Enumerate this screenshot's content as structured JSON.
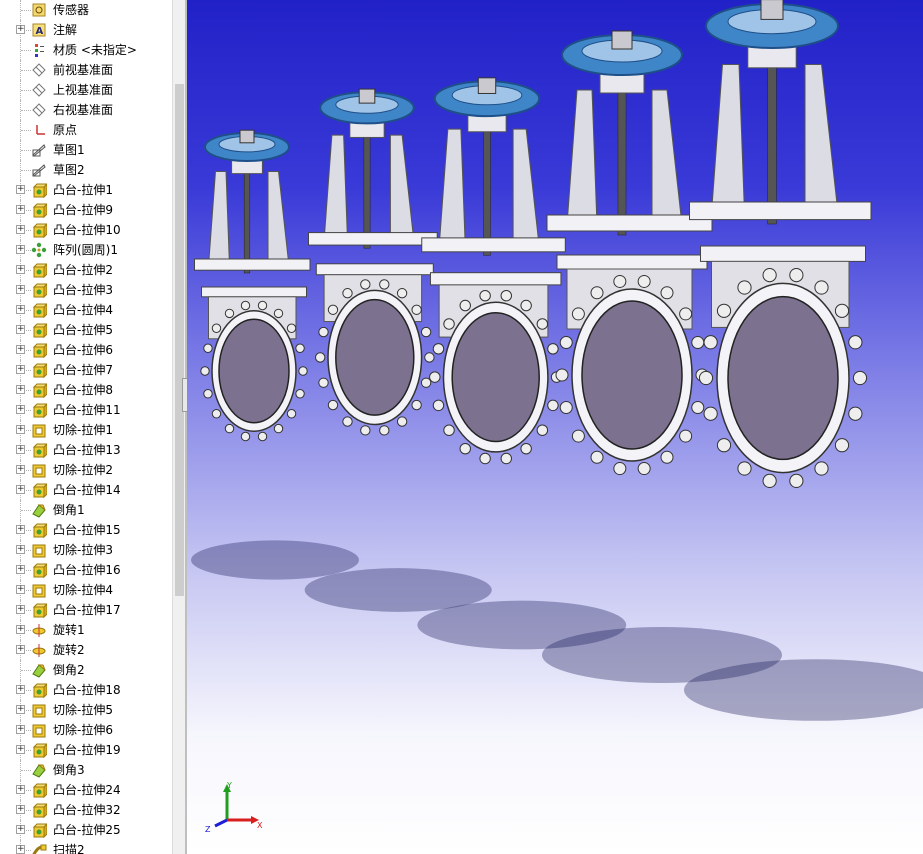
{
  "feature_tree": {
    "items": [
      {
        "label": "传感器",
        "icon": "sensor-icon",
        "expander": false
      },
      {
        "label": "注解",
        "icon": "annotation-icon",
        "expander": true
      },
      {
        "label": "材质 <未指定>",
        "icon": "material-icon",
        "expander": false
      },
      {
        "label": "前视基准面",
        "icon": "plane-icon",
        "expander": false
      },
      {
        "label": "上视基准面",
        "icon": "plane-icon",
        "expander": false
      },
      {
        "label": "右视基准面",
        "icon": "plane-icon",
        "expander": false
      },
      {
        "label": "原点",
        "icon": "origin-icon",
        "expander": false
      },
      {
        "label": "草图1",
        "icon": "sketch-icon",
        "expander": false
      },
      {
        "label": "草图2",
        "icon": "sketch-icon",
        "expander": false
      },
      {
        "label": "凸台-拉伸1",
        "icon": "boss-extrude-icon",
        "expander": true
      },
      {
        "label": "凸台-拉伸9",
        "icon": "boss-extrude-icon",
        "expander": true
      },
      {
        "label": "凸台-拉伸10",
        "icon": "boss-extrude-icon",
        "expander": true
      },
      {
        "label": "阵列(圆周)1",
        "icon": "circular-pattern-icon",
        "expander": true
      },
      {
        "label": "凸台-拉伸2",
        "icon": "boss-extrude-icon",
        "expander": true
      },
      {
        "label": "凸台-拉伸3",
        "icon": "boss-extrude-icon",
        "expander": true
      },
      {
        "label": "凸台-拉伸4",
        "icon": "boss-extrude-icon",
        "expander": true
      },
      {
        "label": "凸台-拉伸5",
        "icon": "boss-extrude-icon",
        "expander": true
      },
      {
        "label": "凸台-拉伸6",
        "icon": "boss-extrude-icon",
        "expander": true
      },
      {
        "label": "凸台-拉伸7",
        "icon": "boss-extrude-icon",
        "expander": true
      },
      {
        "label": "凸台-拉伸8",
        "icon": "boss-extrude-icon",
        "expander": true
      },
      {
        "label": "凸台-拉伸11",
        "icon": "boss-extrude-icon",
        "expander": true
      },
      {
        "label": "切除-拉伸1",
        "icon": "cut-extrude-icon",
        "expander": true
      },
      {
        "label": "凸台-拉伸13",
        "icon": "boss-extrude-icon",
        "expander": true
      },
      {
        "label": "切除-拉伸2",
        "icon": "cut-extrude-icon",
        "expander": true
      },
      {
        "label": "凸台-拉伸14",
        "icon": "boss-extrude-icon",
        "expander": true
      },
      {
        "label": "倒角1",
        "icon": "chamfer-icon",
        "expander": false
      },
      {
        "label": "凸台-拉伸15",
        "icon": "boss-extrude-icon",
        "expander": true
      },
      {
        "label": "切除-拉伸3",
        "icon": "cut-extrude-icon",
        "expander": true
      },
      {
        "label": "凸台-拉伸16",
        "icon": "boss-extrude-icon",
        "expander": true
      },
      {
        "label": "切除-拉伸4",
        "icon": "cut-extrude-icon",
        "expander": true
      },
      {
        "label": "凸台-拉伸17",
        "icon": "boss-extrude-icon",
        "expander": true
      },
      {
        "label": "旋转1",
        "icon": "revolve-icon",
        "expander": true
      },
      {
        "label": "旋转2",
        "icon": "revolve-icon",
        "expander": true
      },
      {
        "label": "倒角2",
        "icon": "chamfer-icon",
        "expander": false
      },
      {
        "label": "凸台-拉伸18",
        "icon": "boss-extrude-icon",
        "expander": true
      },
      {
        "label": "切除-拉伸5",
        "icon": "cut-extrude-icon",
        "expander": true
      },
      {
        "label": "切除-拉伸6",
        "icon": "cut-extrude-icon",
        "expander": true
      },
      {
        "label": "凸台-拉伸19",
        "icon": "boss-extrude-icon",
        "expander": true
      },
      {
        "label": "倒角3",
        "icon": "chamfer-icon",
        "expander": false
      },
      {
        "label": "凸台-拉伸24",
        "icon": "boss-extrude-icon",
        "expander": true
      },
      {
        "label": "凸台-拉伸32",
        "icon": "boss-extrude-icon",
        "expander": true
      },
      {
        "label": "凸台-拉伸25",
        "icon": "boss-extrude-icon",
        "expander": true
      },
      {
        "label": "扫描2",
        "icon": "sweep-icon",
        "expander": true
      }
    ]
  },
  "triad": {
    "x": "X",
    "y": "Y",
    "z": "Z"
  },
  "colors": {
    "viewport_top": "#2121c8",
    "viewport_bottom": "#ffffff",
    "handwheel": "#3f86c8",
    "gate_plate": "#7d7190",
    "body_metal": "#dcdce4",
    "axis_x": "#d81e1e",
    "axis_y": "#1ea01e",
    "axis_z": "#1e1ed8"
  }
}
